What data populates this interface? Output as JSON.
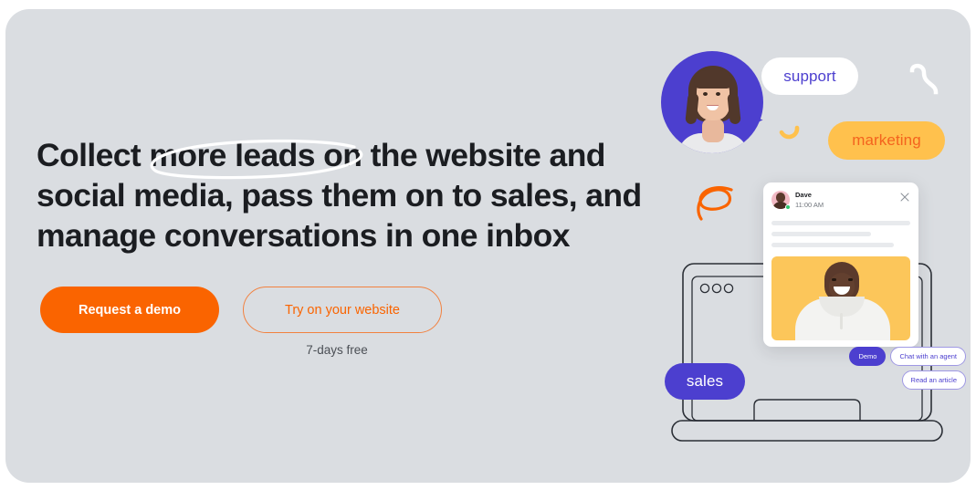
{
  "hero": {
    "headline_lines": [
      "Collect more leads on the website and",
      "social media, pass them on to sales, and",
      "manage conversations in one inbox"
    ],
    "primary_cta": "Request a demo",
    "secondary_cta": "Try on your website",
    "free_note": "7-days free"
  },
  "tags": {
    "support": "support",
    "marketing": "marketing",
    "sales": "sales"
  },
  "chat": {
    "name": "Dave",
    "time": "11:00 AM",
    "close": "×",
    "replies": [
      "Demo",
      "Chat with an agent",
      "Read an article"
    ]
  },
  "colors": {
    "background": "#dadde1",
    "orange": "#fa6400",
    "orange_outline": "#f2813f",
    "purple": "#4c3fcf",
    "yellow": "#ffc14d",
    "photo_yellow": "#fcc65a",
    "text_dark": "#1b1d21",
    "online_green": "#2dc56e"
  }
}
